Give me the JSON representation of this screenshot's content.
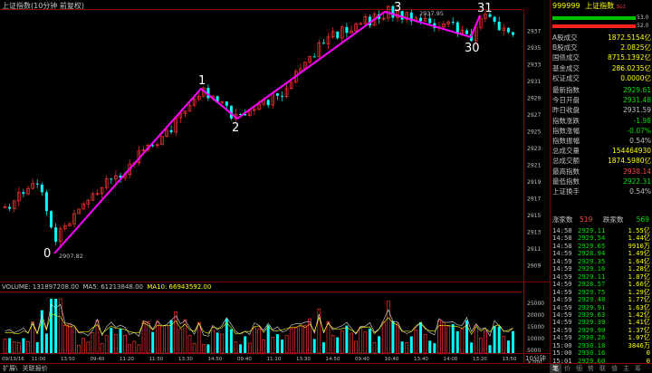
{
  "title": "上证指数(10分钟 前复权)",
  "annotations": [
    {
      "label": "0",
      "value": "2907.82"
    },
    {
      "label": "1"
    },
    {
      "label": "2"
    },
    {
      "label": "3",
      "value": "2937.95"
    },
    {
      "label": "30"
    },
    {
      "label": "31"
    }
  ],
  "volume_legend": {
    "vol": "VOLUME: 131897208.00",
    "ma5": "MA5: 61213848.00",
    "ma10": "MA10: 66943592.00"
  },
  "price_ticks": [
    "2937",
    "2935",
    "2933",
    "2931",
    "2929",
    "2927",
    "2925",
    "2923",
    "2921",
    "2919",
    "2917",
    "2915",
    "2913",
    "2911",
    "2909"
  ],
  "volume_ticks": [
    "25000",
    "20000",
    "15000",
    "10000",
    "5000",
    "×100"
  ],
  "time_labels": [
    "09/13/16",
    "11:00",
    "13:50",
    "09:40",
    "11:20",
    "11:50",
    "13:30",
    "14:50",
    "09:40",
    "11:10",
    "13:30",
    "14:50",
    "09:40",
    "10:40",
    "13:40",
    "14:00",
    "13:20",
    "13:50"
  ],
  "period_label": "10分钟",
  "bottom_tabs": [
    "扩展\\",
    "关联报价"
  ],
  "right_panel": {
    "code": "999999",
    "name": "上证指数",
    "suffix": "SG1",
    "bar1_value": "53.0",
    "bar2_value": "52.0",
    "stats": [
      {
        "label": "A股成交",
        "value": "1872.5154亿",
        "color": "#ffff00"
      },
      {
        "label": "B股成交",
        "value": "2.0825亿",
        "color": "#ffff00"
      },
      {
        "label": "国债成交",
        "value": "8715.1392亿",
        "color": "#ffff00"
      },
      {
        "label": "基金成交",
        "value": "286.0235亿",
        "color": "#ffff00"
      },
      {
        "label": "权证成交",
        "value": "0.0000亿",
        "color": "#ffff00"
      }
    ],
    "quote": [
      {
        "label": "最新指数",
        "value": "2929.61",
        "color": "#00e000"
      },
      {
        "label": "今日开盘",
        "value": "2931.48",
        "color": "#00e000"
      },
      {
        "label": "昨日收盘",
        "value": "2931.59",
        "color": "#c0c0c0"
      },
      {
        "label": "指数涨跌",
        "value": "-1.98",
        "color": "#00e000"
      },
      {
        "label": "指数涨幅",
        "value": "-0.07%",
        "color": "#00e000"
      },
      {
        "label": "指数振幅",
        "value": "0.54%",
        "color": "#c0c0c0"
      },
      {
        "label": "总成交量",
        "value": "154464930",
        "color": "#ffff00"
      },
      {
        "label": "总成交额",
        "value": "1874.5980亿",
        "color": "#ffff00"
      },
      {
        "label": "最高指数",
        "value": "2938.14",
        "color": "#ff4040"
      },
      {
        "label": "最低指数",
        "value": "2922.31",
        "color": "#00e000"
      },
      {
        "label": "上证换手",
        "value": "0.54%",
        "color": "#c0c0c0"
      }
    ],
    "updown": {
      "up_label": "涨家数",
      "up_value": "519",
      "down_label": "跌家数",
      "down_value": "569"
    },
    "ticks": [
      {
        "time": "14:58",
        "price": "2929.11",
        "vol": "1.55亿",
        "pc": "#00e000",
        "vc": "#ffff00"
      },
      {
        "time": "14:58",
        "price": "2929.54",
        "vol": "1.44亿",
        "pc": "#00e000",
        "vc": "#ffff00"
      },
      {
        "time": "14:58",
        "price": "2929.65",
        "vol": "9910万",
        "pc": "#00e000",
        "vc": "#ffff00"
      },
      {
        "time": "14:59",
        "price": "2928.94",
        "vol": "1.49亿",
        "pc": "#00e000",
        "vc": "#ffff00"
      },
      {
        "time": "14:59",
        "price": "2929.35",
        "vol": "1.64亿",
        "pc": "#00e000",
        "vc": "#ffff00"
      },
      {
        "time": "14:59",
        "price": "2929.16",
        "vol": "1.28亿",
        "pc": "#00e000",
        "vc": "#ffff00"
      },
      {
        "time": "14:59",
        "price": "2929.11",
        "vol": "1.87亿",
        "pc": "#00e000",
        "vc": "#ffff00"
      },
      {
        "time": "14:59",
        "price": "2928.57",
        "vol": "1.66亿",
        "pc": "#00e000",
        "vc": "#ffff00"
      },
      {
        "time": "14:59",
        "price": "2929.75",
        "vol": "1.29亿",
        "pc": "#00e000",
        "vc": "#ffff00"
      },
      {
        "time": "14:59",
        "price": "2929.48",
        "vol": "1.77亿",
        "pc": "#00e000",
        "vc": "#ffff00"
      },
      {
        "time": "14:59",
        "price": "2929.91",
        "vol": "1.63亿",
        "pc": "#00e000",
        "vc": "#ffff00"
      },
      {
        "time": "14:59",
        "price": "2929.63",
        "vol": "1.42亿",
        "pc": "#00e000",
        "vc": "#ffff00"
      },
      {
        "time": "14:59",
        "price": "2929.39",
        "vol": "1.41亿",
        "pc": "#00e000",
        "vc": "#ffff00"
      },
      {
        "time": "14:59",
        "price": "2929.90",
        "vol": "1.37亿",
        "pc": "#00e000",
        "vc": "#ffff00"
      },
      {
        "time": "14:59",
        "price": "2930.26",
        "vol": "1.07亿",
        "pc": "#00e000",
        "vc": "#ffff00"
      },
      {
        "time": "15:00",
        "price": "2930.18",
        "vol": "3846万",
        "pc": "#00e000",
        "vc": "#ffff00"
      },
      {
        "time": "15:00",
        "price": "2930.16",
        "vol": "0",
        "pc": "#00e000",
        "vc": "#ffff00"
      },
      {
        "time": "15:01",
        "price": "2929.60",
        "vol": "0",
        "pc": "#00e000",
        "vc": "#ffff00"
      }
    ],
    "tabs": [
      "笔",
      "价",
      "细",
      "势",
      "联",
      "值",
      "主",
      "筹"
    ]
  }
}
